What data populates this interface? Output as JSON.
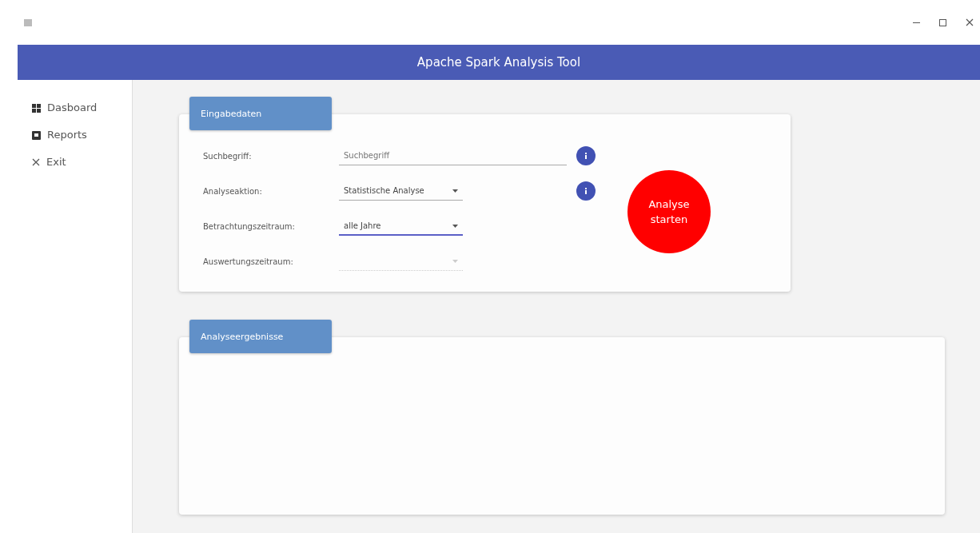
{
  "window": {
    "title": "Apache Spark Analysis Tool"
  },
  "sidebar": {
    "items": [
      {
        "label": "Dasboard",
        "kind": "grid"
      },
      {
        "label": "Reports",
        "kind": "report"
      },
      {
        "label": "Exit",
        "kind": "close"
      }
    ]
  },
  "input_card": {
    "title": "Eingabedaten",
    "fields": [
      {
        "label": "Suchbegriff:",
        "kind": "text",
        "placeholder": "Suchbegriff",
        "focused": false,
        "disabled": false,
        "info": true
      },
      {
        "label": "Analyseaktion:",
        "kind": "select",
        "value": "Statistische Analyse",
        "focused": false,
        "disabled": false,
        "info": true
      },
      {
        "label": "Betrachtungszeitraum:",
        "kind": "select",
        "value": "alle Jahre",
        "focused": true,
        "disabled": false,
        "info": false
      },
      {
        "label": "Auswertungszeitraum:",
        "kind": "select",
        "focused": false,
        "disabled": true,
        "info": false
      }
    ],
    "start_button": {
      "label": "Analyse starten"
    }
  },
  "results_card": {
    "title": "Analyseergebnisse"
  }
}
